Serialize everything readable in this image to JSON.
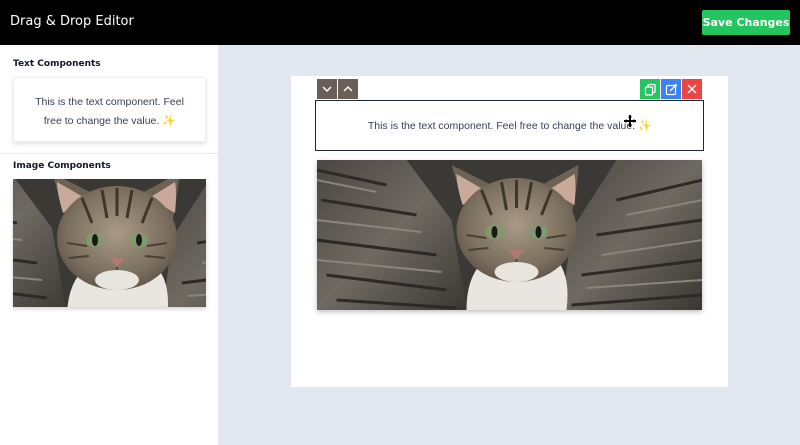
{
  "header": {
    "title": "Drag & Drop Editor",
    "save_label": "Save Changes"
  },
  "sidebar": {
    "text_section_title": "Text Components",
    "text_component": "This is the text component. Feel free to change the value.",
    "image_section_title": "Image Components"
  },
  "canvas": {
    "text_component": "This is the text component. Feel free to change the value."
  },
  "icons": {
    "move_down": "chevron-down-icon",
    "move_up": "chevron-up-icon",
    "duplicate": "copy-icon",
    "edit": "pencil-icon",
    "delete": "close-icon",
    "sparkle": "sparkles-icon",
    "cursor": "move-cursor-icon"
  },
  "colors": {
    "header_bg": "#000000",
    "save_button": "#22c55e",
    "duplicate_button": "#22c55e",
    "edit_button": "#3b82f6",
    "delete_button": "#ef4444",
    "move_button": "#6b5e57",
    "workspace_bg": "#e2e8f0"
  }
}
